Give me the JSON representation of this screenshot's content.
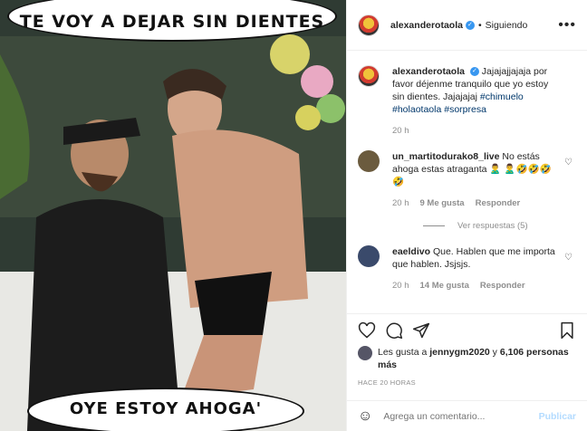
{
  "media": {
    "caption_top": "TE VOY A DEJAR SIN DIENTES",
    "caption_bottom": "OYE ESTOY AHOGA'"
  },
  "header": {
    "username": "alexanderotaola",
    "verified_icon": "✓",
    "separator": "•",
    "follow_state": "Siguiendo",
    "more_icon": "•••"
  },
  "caption": {
    "username": "alexanderotaola",
    "text": "Jajajajjajaja por favor déjenme tranquilo que yo estoy sin dientes. Jajajajaj ",
    "tags": [
      "#chimuelo",
      "#holaotaola",
      "#sorpresa"
    ],
    "time": "20 h"
  },
  "comments": [
    {
      "username": "un_martitodurako8_live",
      "text": "No estás ahoga estas atraganta 🙎‍♂️ 🙎‍♂️🤣🤣🤣🤣",
      "time": "20 h",
      "likes": "9 Me gusta",
      "reply": "Responder",
      "view_replies": "Ver respuestas (5)"
    },
    {
      "username": "eaeldivo",
      "text": "Que. Hablen que me importa que hablen. Jsjsjs.",
      "time": "20 h",
      "likes": "14 Me gusta",
      "reply": "Responder"
    }
  ],
  "likes": {
    "prefix": "Les gusta a ",
    "user": "jennygm2020",
    "mid": " y ",
    "others": "6,106 personas más"
  },
  "time_ago": "HACE 20 HORAS",
  "add_comment": {
    "emoji_icon": "☺",
    "placeholder": "Agrega un comentario...",
    "publish": "Publicar"
  },
  "colors": {
    "link": "#00376b",
    "verified": "#3897f0",
    "muted": "#8e8e8e",
    "publish_disabled": "#b3dbff"
  }
}
